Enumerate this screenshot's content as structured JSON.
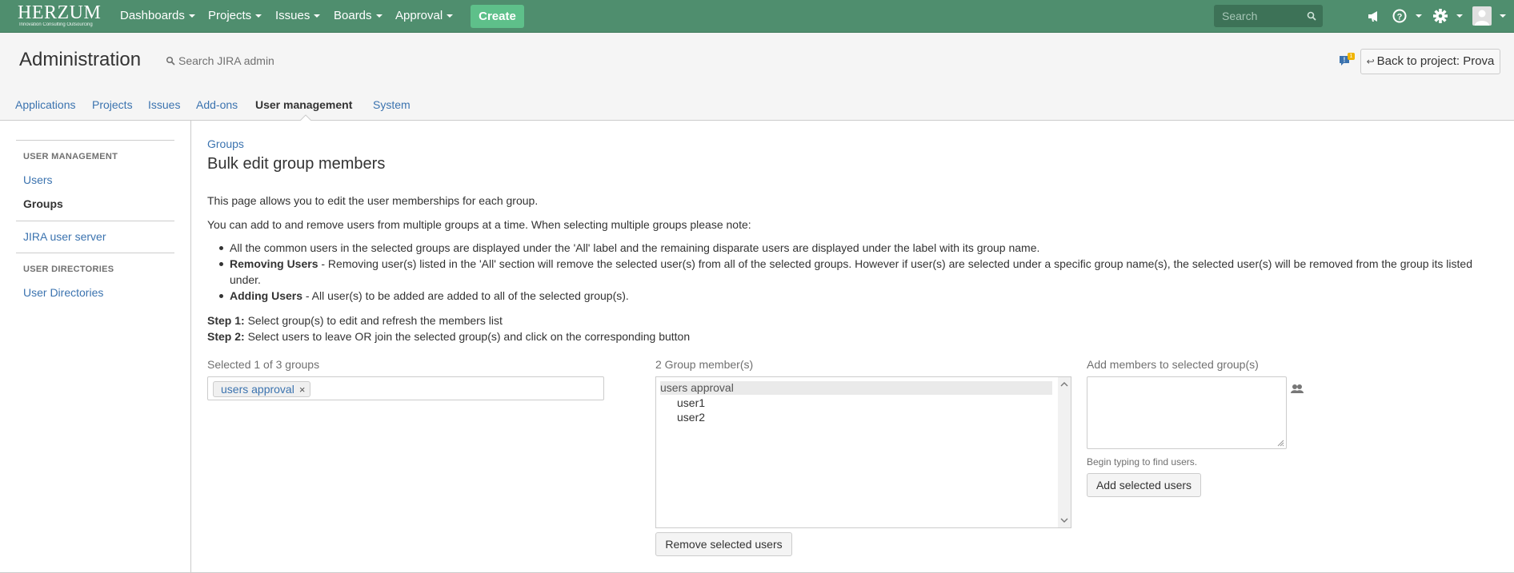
{
  "topnav": {
    "logo": {
      "text": "HERZUM",
      "tagline": "Innovation Consulting Outsourcing"
    },
    "menus": [
      {
        "label": "Dashboards"
      },
      {
        "label": "Projects"
      },
      {
        "label": "Issues"
      },
      {
        "label": "Boards"
      },
      {
        "label": "Approval"
      }
    ],
    "create_label": "Create",
    "search_placeholder": "Search",
    "icons": [
      "feedback-megaphone-icon",
      "help-icon",
      "settings-gear-icon",
      "user-avatar-icon"
    ],
    "colors": {
      "bar": "#4f8e6e",
      "create": "#5ec08a"
    }
  },
  "admin": {
    "title": "Administration",
    "search_placeholder": "Search JIRA admin",
    "notification_count": "1",
    "back_label": "Back to project: Prova",
    "tabs": [
      {
        "label": "Applications"
      },
      {
        "label": "Projects"
      },
      {
        "label": "Issues"
      },
      {
        "label": "Add-ons"
      },
      {
        "label": "User management",
        "active": true
      },
      {
        "label": "System"
      }
    ]
  },
  "sidebar": {
    "section1": "USER MANAGEMENT",
    "items1": [
      {
        "label": "Users"
      },
      {
        "label": "Groups",
        "selected": true
      }
    ],
    "item_jira_server": "JIRA user server",
    "section2": "USER DIRECTORIES",
    "items2": [
      {
        "label": "User Directories"
      }
    ]
  },
  "main": {
    "breadcrumb": "Groups",
    "title": "Bulk edit group members",
    "intro": "This page allows you to edit the user memberships for each group.",
    "note": "You can add to and remove users from multiple groups at a time. When selecting multiple groups please note:",
    "bullets": [
      {
        "bold": "",
        "text": "All the common users in the selected groups are displayed under the 'All' label and the remaining disparate users are displayed under the label with its group name."
      },
      {
        "bold": "Removing Users",
        "text": " - Removing user(s) listed in the 'All' section will remove the selected user(s) from all of the selected groups. However if user(s) are selected under a specific group name(s), the selected user(s) will be removed from the group its listed under."
      },
      {
        "bold": "Adding Users",
        "text": " - All user(s) to be added are added to all of the selected group(s)."
      }
    ],
    "steps": [
      {
        "label": "Step 1:",
        "text": " Select group(s) to edit and refresh the members list"
      },
      {
        "label": "Step 2:",
        "text": " Select users to leave OR join the selected group(s) and click on the corresponding button"
      }
    ],
    "groups_label": "Selected 1 of 3 groups",
    "selected_group": "users approval",
    "members_label": "2 Group member(s)",
    "member_group": "users approval",
    "members": [
      "user1",
      "user2"
    ],
    "remove_button": "Remove selected users",
    "add_label": "Add members to selected group(s)",
    "add_hint": "Begin typing to find users.",
    "add_button": "Add selected users"
  }
}
